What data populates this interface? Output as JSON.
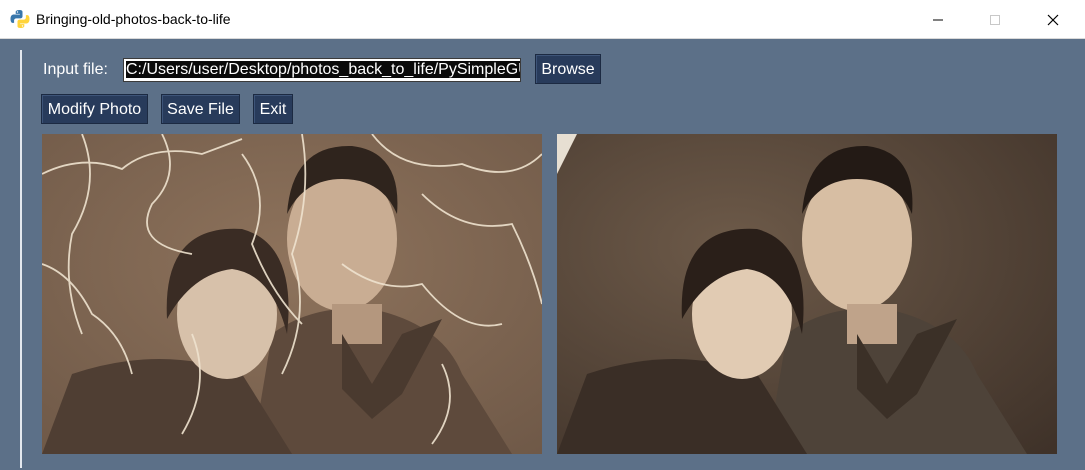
{
  "window": {
    "title": "Bringing-old-photos-back-to-life",
    "icon": "python-icon"
  },
  "form": {
    "input_label": "Input file:",
    "input_value": "C:/Users/user/Desktop/photos_back_to_life/PySimpleGUI",
    "browse_label": "Browse"
  },
  "actions": {
    "modify_label": "Modify Photo",
    "save_label": "Save File",
    "exit_label": "Exit"
  },
  "images": {
    "original": "original damaged photo",
    "restored": "restored photo"
  },
  "colors": {
    "background": "#5c7088",
    "button": "#283b5b",
    "text": "#ffffff"
  }
}
